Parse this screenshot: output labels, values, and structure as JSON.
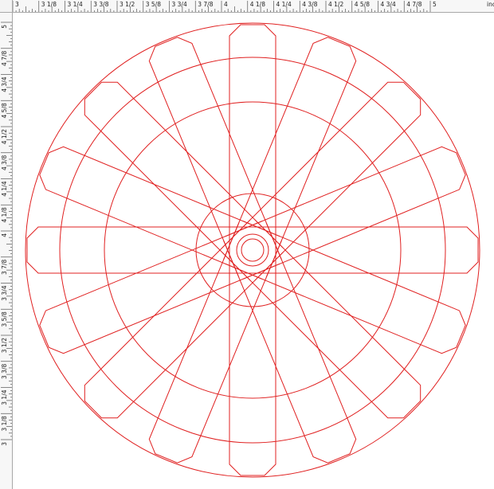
{
  "ruler": {
    "unit_label": "inches",
    "top_labels": [
      "3",
      "3 1/8",
      "3 1/4",
      "3 3/8",
      "3 1/2",
      "3 5/8",
      "3 3/4",
      "3 7/8",
      "4",
      "4 1/8",
      "4 1/4",
      "4 3/8",
      "4 1/2",
      "4 5/8",
      "4 3/4",
      "4 7/8",
      "5"
    ],
    "left_labels": [
      "5",
      "4 7/8",
      "4 3/4",
      "4 5/8",
      "4 1/2",
      "4 3/8",
      "4 1/4",
      "4 1/8",
      "4",
      "3 7/8",
      "3 3/4",
      "3 5/8",
      "3 1/2",
      "3 3/8",
      "3 1/4",
      "3 1/8",
      "3"
    ]
  },
  "drawing": {
    "stroke_color": "#e02020",
    "spoke_count": 16
  }
}
